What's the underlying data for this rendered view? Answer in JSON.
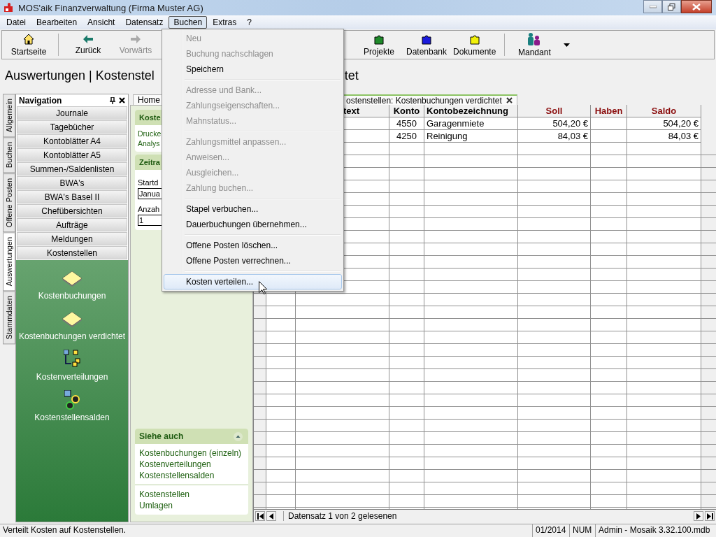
{
  "window": {
    "title": "MOS'aik Finanzverwaltung (Firma Muster AG)"
  },
  "menubar": [
    {
      "label": "Datei",
      "selected": false
    },
    {
      "label": "Bearbeiten",
      "selected": false
    },
    {
      "label": "Ansicht",
      "selected": false
    },
    {
      "label": "Datensatz",
      "selected": false
    },
    {
      "label": "Buchen",
      "selected": true
    },
    {
      "label": "Extras",
      "selected": false
    },
    {
      "label": "?",
      "selected": false
    }
  ],
  "toolbar": {
    "left": [
      {
        "label": "Startseite",
        "disabled": false
      },
      {
        "label": "Zurück",
        "disabled": false
      },
      {
        "label": "Vorwärts",
        "disabled": true
      }
    ],
    "right": [
      {
        "label": "Projekte",
        "disabled": false
      },
      {
        "label": "Datenbank",
        "disabled": false
      },
      {
        "label": "Dokumente",
        "disabled": false
      },
      {
        "label": "Mandant",
        "disabled": false
      }
    ]
  },
  "heading": {
    "left": "Auswertungen | Kostenstel",
    "right": "tet"
  },
  "side_tabs": [
    {
      "label": "Allgemein",
      "selected": false
    },
    {
      "label": "Buchen",
      "selected": false
    },
    {
      "label": "Offene Posten",
      "selected": false
    },
    {
      "label": "Auswertungen",
      "selected": true
    },
    {
      "label": "Stammdaten",
      "selected": false
    }
  ],
  "navigation": {
    "title": "Navigation",
    "buttons": [
      "Journale",
      "Tagebücher",
      "Kontoblätter A4",
      "Kontoblätter A5",
      "Summen-/Saldenlisten",
      "BWA's",
      "BWA's Basel II",
      "Chefübersichten",
      "Aufträge",
      "Meldungen",
      "Kostenstellen"
    ],
    "items": [
      "Kostenbuchungen",
      "Kostenbuchungen verdichtet",
      "Kostenverteilungen",
      "Kostenstellensalden"
    ]
  },
  "doc_tabs": [
    {
      "label": "Home",
      "selected": false
    },
    {
      "label": "ostenstellen: Kostenbuchungen verdichtet",
      "selected": true
    }
  ],
  "task_pane": {
    "cards": [
      {
        "title": "Koste",
        "links": [
          "Drucke",
          "Analys"
        ]
      },
      {
        "title": "Zeitra",
        "fields": [
          {
            "label": "Startd",
            "value": "Janua"
          },
          {
            "label": "Anzah",
            "value": "1"
          }
        ]
      }
    ],
    "see_also": {
      "title": "Siehe auch",
      "links": [
        "Kostenbuchungen (einzeln)",
        "Kostenverteilungen",
        "Kostenstellensalden"
      ],
      "more_links": [
        "Kostenstellen",
        "Umlagen"
      ]
    }
  },
  "table": {
    "columns": [
      {
        "label": "text",
        "kind": "text"
      },
      {
        "label": "Konto",
        "kind": "number"
      },
      {
        "label": "Kontobezeichnung",
        "kind": "text"
      },
      {
        "label": "Soll",
        "kind": "amount"
      },
      {
        "label": "Haben",
        "kind": "amount"
      },
      {
        "label": "Saldo",
        "kind": "amount"
      }
    ],
    "rows": [
      [
        null,
        "4550",
        "Garagenmiete",
        "504,20 €",
        null,
        "504,20 €"
      ],
      [
        null,
        "4250",
        "Reinigung",
        "84,03 €",
        null,
        "84,03 €"
      ]
    ],
    "record_info": "Datensatz 1 von 2 gelesenen"
  },
  "menu": {
    "items": [
      {
        "kind": "item",
        "label": "Neu",
        "disabled": true,
        "selected": false
      },
      {
        "kind": "item",
        "label": "Buchung nachschlagen",
        "disabled": true,
        "selected": false
      },
      {
        "kind": "item",
        "label": "Speichern",
        "disabled": false,
        "selected": false
      },
      {
        "kind": "separator"
      },
      {
        "kind": "item",
        "label": "Adresse und Bank...",
        "disabled": true,
        "selected": false
      },
      {
        "kind": "item",
        "label": "Zahlungseigenschaften...",
        "disabled": true,
        "selected": false
      },
      {
        "kind": "item",
        "label": "Mahnstatus...",
        "disabled": true,
        "selected": false
      },
      {
        "kind": "separator"
      },
      {
        "kind": "item",
        "label": "Zahlungsmittel anpassen...",
        "disabled": true,
        "selected": false
      },
      {
        "kind": "item",
        "label": "Anweisen...",
        "disabled": true,
        "selected": false
      },
      {
        "kind": "item",
        "label": "Ausgleichen...",
        "disabled": true,
        "selected": false
      },
      {
        "kind": "item",
        "label": "Zahlung buchen...",
        "disabled": true,
        "selected": false
      },
      {
        "kind": "separator"
      },
      {
        "kind": "item",
        "label": "Stapel verbuchen...",
        "disabled": false,
        "selected": false
      },
      {
        "kind": "item",
        "label": "Dauerbuchungen übernehmen...",
        "disabled": false,
        "selected": false
      },
      {
        "kind": "separator"
      },
      {
        "kind": "item",
        "label": "Offene Posten löschen...",
        "disabled": false,
        "selected": false
      },
      {
        "kind": "item",
        "label": "Offene Posten verrechnen...",
        "disabled": false,
        "selected": false
      },
      {
        "kind": "separator"
      },
      {
        "kind": "item",
        "label": "Kosten verteilen...",
        "disabled": false,
        "selected": true
      }
    ]
  },
  "status_bar": {
    "message": "Verteilt Kosten auf Kostenstellen.",
    "period": "01/2014",
    "num": "NUM",
    "user": "Admin - Mosaik 3.32.100.mdb"
  }
}
